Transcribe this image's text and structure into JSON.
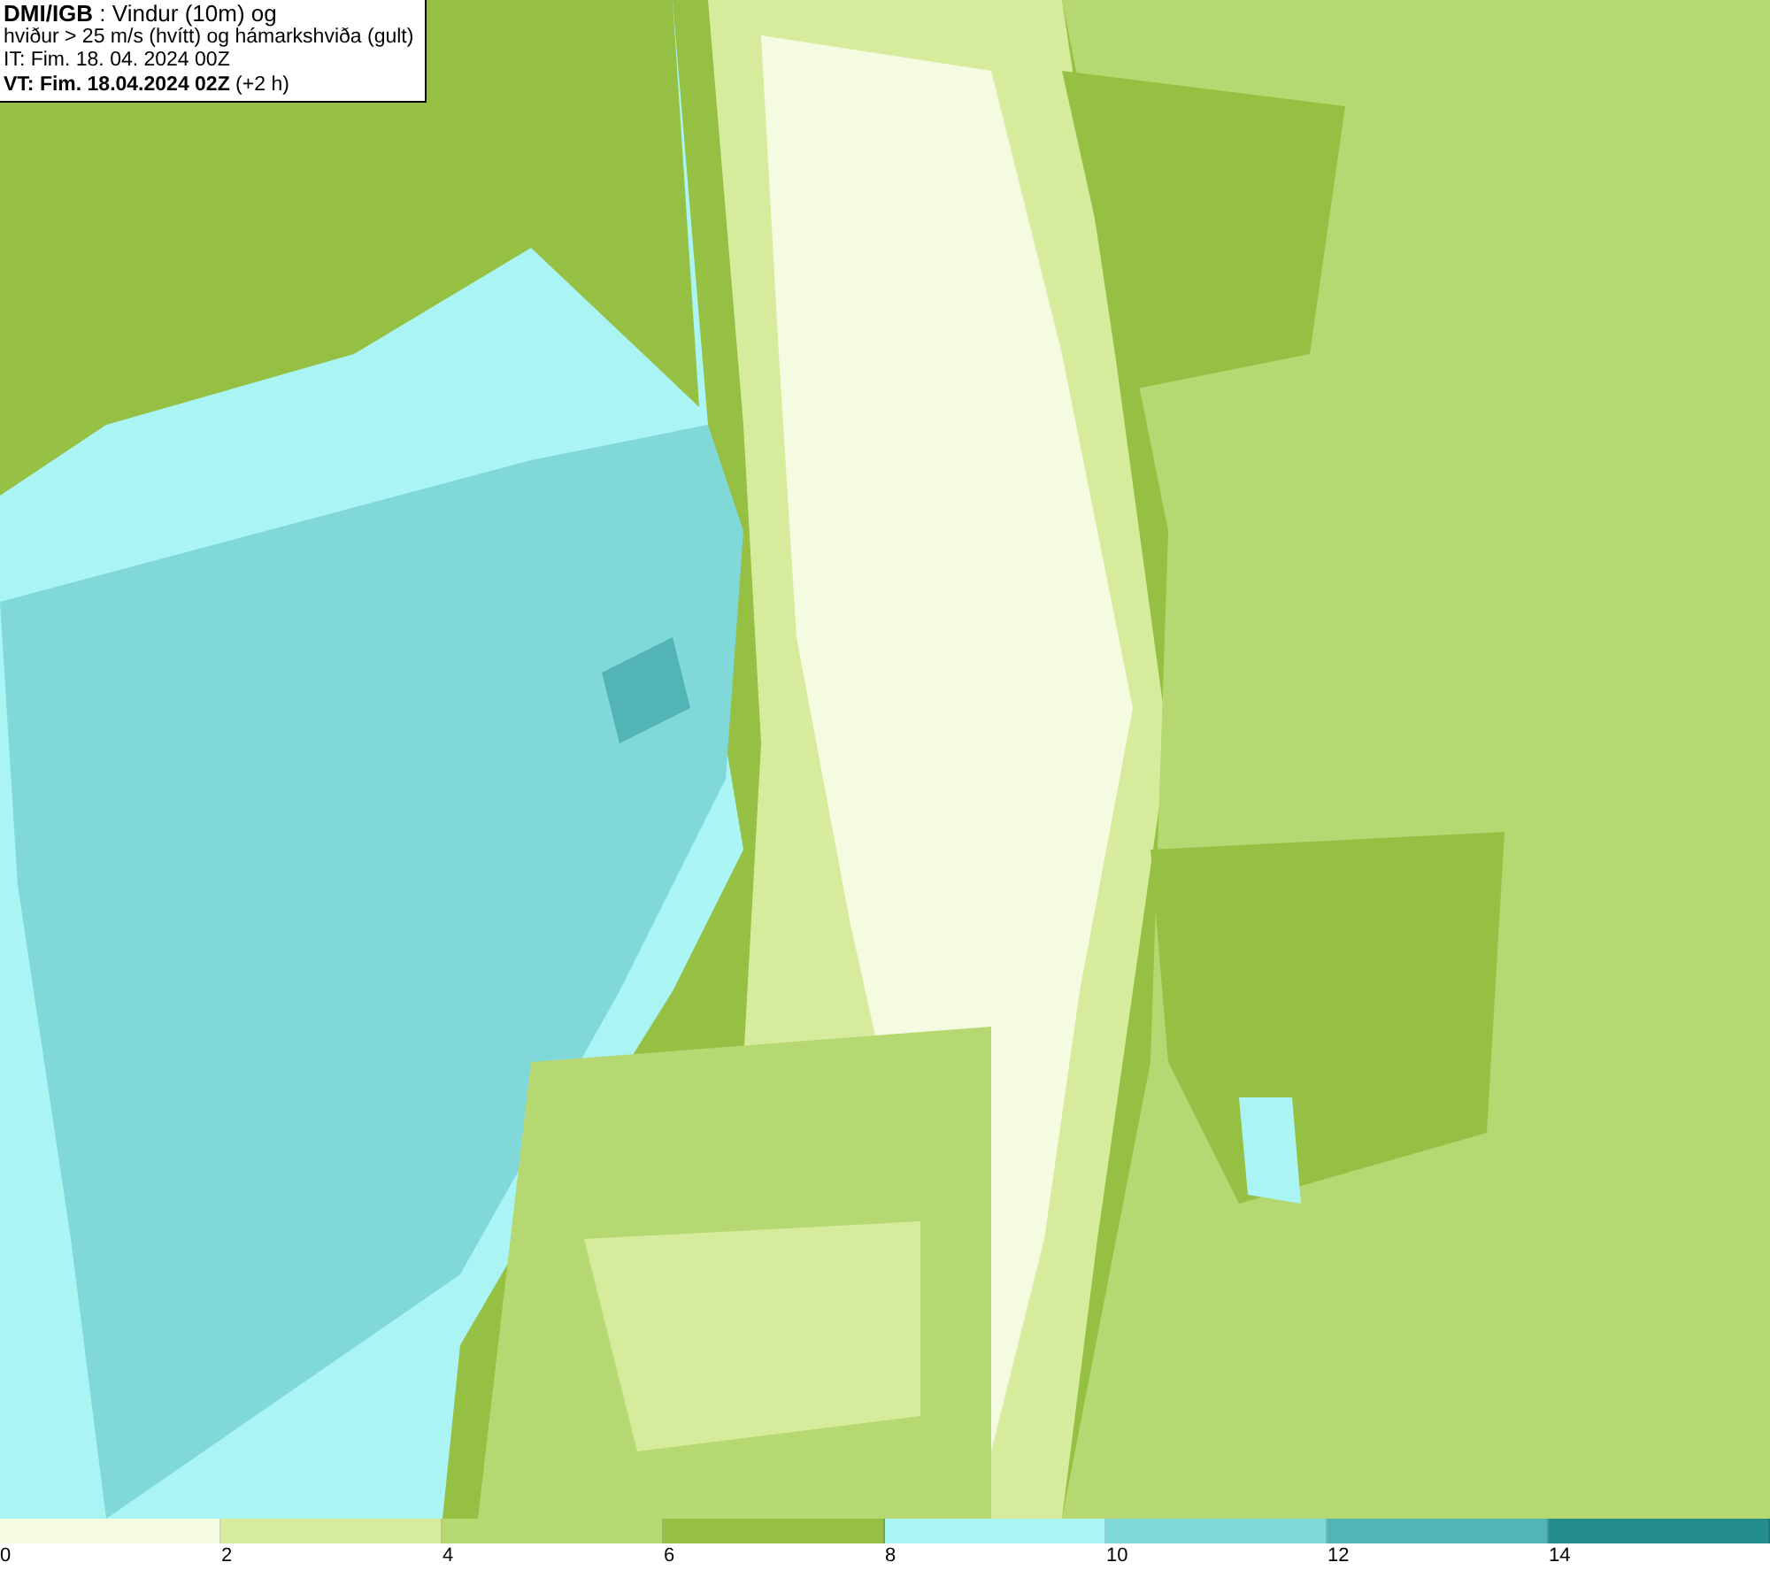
{
  "header": {
    "lines": [
      "**DMI/IGB** : Vindur (10m) og",
      "hviður > 25 m/s (hvítt) og hámarkshviða (gult)",
      "IT: Fim. 18. 04. 2024 00Z",
      "**VT: Fim. 18.04.2024 02Z** (+2 h)"
    ]
  },
  "legend": {
    "bins": [
      {
        "label": "0",
        "color": "#f4fbe0"
      },
      {
        "label": "2",
        "color": "#d6ec9c"
      },
      {
        "label": "4",
        "color": "#b6d872"
      },
      {
        "label": "6",
        "color": "#96c044"
      },
      {
        "label": "8",
        "color": "#aaf4f4"
      },
      {
        "label": "10",
        "color": "#80d8d8"
      },
      {
        "label": "12",
        "color": "#52b4b4"
      },
      {
        "label": "14",
        "color": "#248e8c"
      }
    ]
  }
}
